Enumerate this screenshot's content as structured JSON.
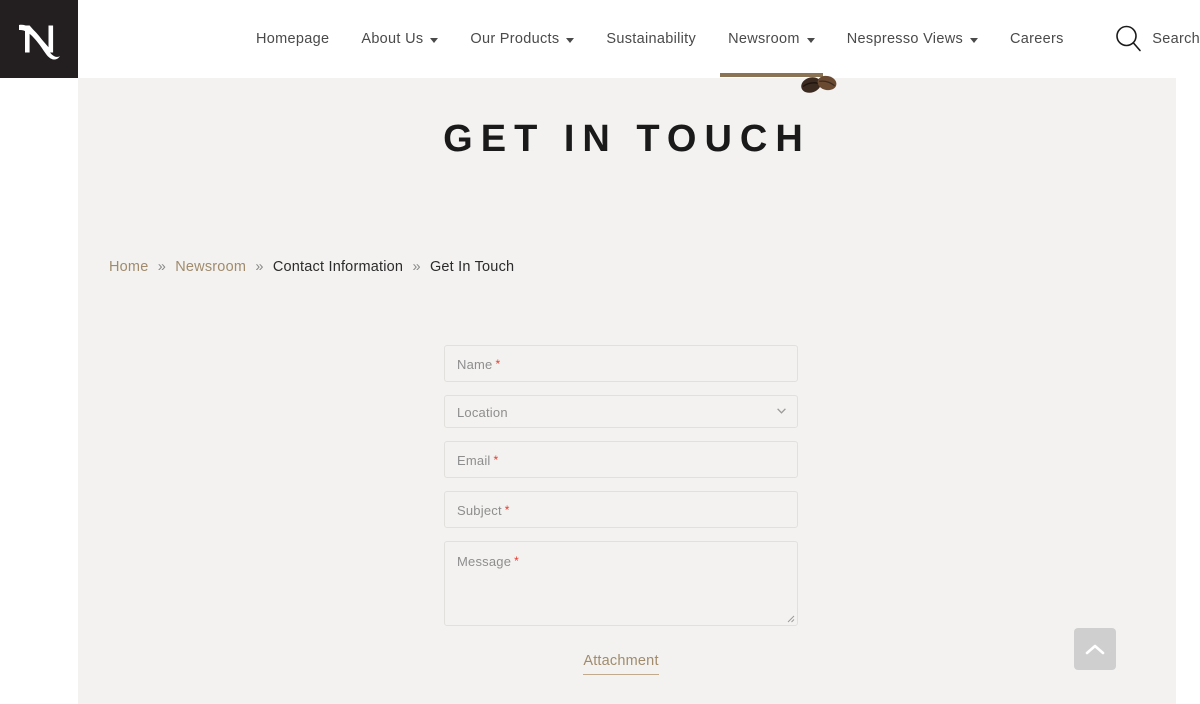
{
  "header": {
    "logo_alt": "Nespresso",
    "nav_items": [
      {
        "label": "Homepage",
        "has_dropdown": false,
        "active": false
      },
      {
        "label": "About Us",
        "has_dropdown": true,
        "active": false
      },
      {
        "label": "Our Products",
        "has_dropdown": true,
        "active": false
      },
      {
        "label": "Sustainability",
        "has_dropdown": false,
        "active": false
      },
      {
        "label": "Newsroom",
        "has_dropdown": true,
        "active": true
      },
      {
        "label": "Nespresso Views",
        "has_dropdown": true,
        "active": false
      },
      {
        "label": "Careers",
        "has_dropdown": false,
        "active": false
      }
    ],
    "search_label": "Search"
  },
  "hero": {
    "title": "GET IN TOUCH"
  },
  "breadcrumb": {
    "separator": "»",
    "items": [
      {
        "label": "Home",
        "is_link": true
      },
      {
        "label": "Newsroom",
        "is_link": true
      },
      {
        "label": "Contact Information",
        "is_link": false
      },
      {
        "label": "Get In Touch",
        "is_link": false
      }
    ]
  },
  "form": {
    "fields": [
      {
        "name": "name",
        "placeholder": "Name",
        "required": true,
        "type": "text",
        "value": ""
      },
      {
        "name": "location",
        "placeholder": "Location",
        "required": false,
        "type": "select",
        "value": ""
      },
      {
        "name": "email",
        "placeholder": "Email",
        "required": true,
        "type": "text",
        "value": ""
      },
      {
        "name": "subject",
        "placeholder": "Subject",
        "required": true,
        "type": "text",
        "value": ""
      },
      {
        "name": "message",
        "placeholder": "Message",
        "required": true,
        "type": "textarea",
        "value": ""
      }
    ],
    "required_marker": "*",
    "attachment_label": "Attachment"
  },
  "scroll_top": {
    "icon": "chevron-up-icon"
  },
  "colors": {
    "accent_gold": "#a08c6d",
    "active_underline": "#8b7355",
    "content_bg": "#f3f2f0",
    "logo_bg": "#231f20",
    "required_red": "#e8392a",
    "text_dark": "#2b2b2b",
    "placeholder_gray": "#8e8e8e",
    "scroll_top_bg": "#cfcfcf"
  }
}
